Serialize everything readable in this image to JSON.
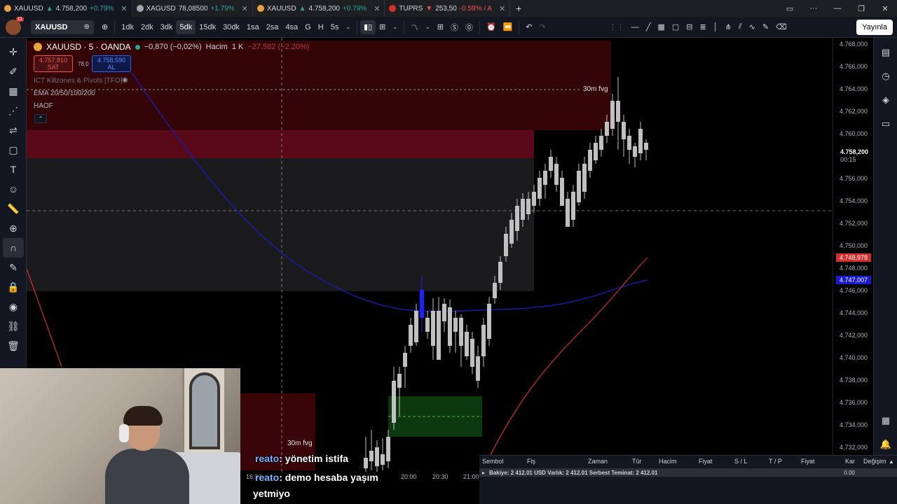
{
  "browser_tabs": [
    {
      "symbol": "XAUUSD",
      "price": "4.758,200",
      "change": "+0.79%",
      "direction": "up",
      "color": "#e8a33d",
      "active": true
    },
    {
      "symbol": "XAGUSD",
      "price": "78,08500",
      "change": "+1.79%",
      "direction": "up",
      "color": "#9fa6b2",
      "active": false
    },
    {
      "symbol": "XAUUSD",
      "price": "4.758,200",
      "change": "+0.79%",
      "direction": "up",
      "color": "#e8a33d",
      "active": false
    },
    {
      "symbol": "TUPRS",
      "price": "253,50",
      "change": "-0.59% / A",
      "direction": "down",
      "color": "#d32f2f",
      "active": false
    }
  ],
  "toolbar": {
    "notification_count": "11",
    "symbol": "XAUUSD",
    "intervals": [
      "1dk",
      "2dk",
      "3dk",
      "5dk",
      "15dk",
      "30dk",
      "1sa",
      "2sa",
      "4sa",
      "G",
      "H",
      "5s"
    ],
    "active_interval": "5dk",
    "publish_label": "Yayınla"
  },
  "legend": {
    "title": "XAUUSD · 5 · OANDA",
    "change": "−0,870 (−0,02%)",
    "volume_label": "Hacim",
    "volume_value": "1 K",
    "volume_delta": "−27.582 (−2.20%)",
    "sell_price": "4.757,810",
    "sell_label": "SAT",
    "spread": "78,0",
    "buy_price": "4.758,590",
    "buy_label": "AL",
    "indicators": [
      "ICT Killzones & Pivots [TFO]",
      "EMA 20/50/100/200",
      "HAOF"
    ]
  },
  "annotations": {
    "fvg_top": "30m fvg",
    "fvg_bottom": "30m fvg"
  },
  "price_axis": {
    "labels": [
      "4.768,000",
      "4.766,000",
      "4.764,000",
      "4.762,000",
      "4.760,000",
      "4.758,200",
      "4.756,000",
      "4.754,000",
      "4.752,000",
      "4.750,000",
      "4.748,000",
      "4.746,000",
      "4.744,000",
      "4.742,000",
      "4.740,000",
      "4.738,000",
      "4.736,000",
      "4.734,000",
      "4.732,000"
    ],
    "current_price": "4.758,200",
    "countdown": "00:15",
    "ema_red": "4.748,978",
    "ema_blue": "4.747,007"
  },
  "time_axis": [
    "16:30",
    "20:00",
    "20:30",
    "21:00"
  ],
  "chat": [
    {
      "user": "reato",
      "message": ": yönetim istifa"
    },
    {
      "user": "reato",
      "message": ": demo hesaba yaşım"
    },
    {
      "user": "",
      "message": "yetmiyo"
    }
  ],
  "trade_panel": {
    "headers": [
      "Sembol",
      "Fiş",
      "Zaman",
      "Tür",
      "Hacim",
      "Fiyat",
      "S / L",
      "T / P",
      "Fiyat",
      "Kar",
      "Değişim"
    ],
    "balance_line": "Bakiye: 2 412.01 USD   Varlık: 2 412.01   Serbest Teminat: 2 412.01",
    "total": "0.00"
  },
  "colors": {
    "bull": "#1f1fff",
    "bear": "#c0c0c0",
    "ema_red": "#d32f2f",
    "ema_blue": "#1a1aa8"
  }
}
